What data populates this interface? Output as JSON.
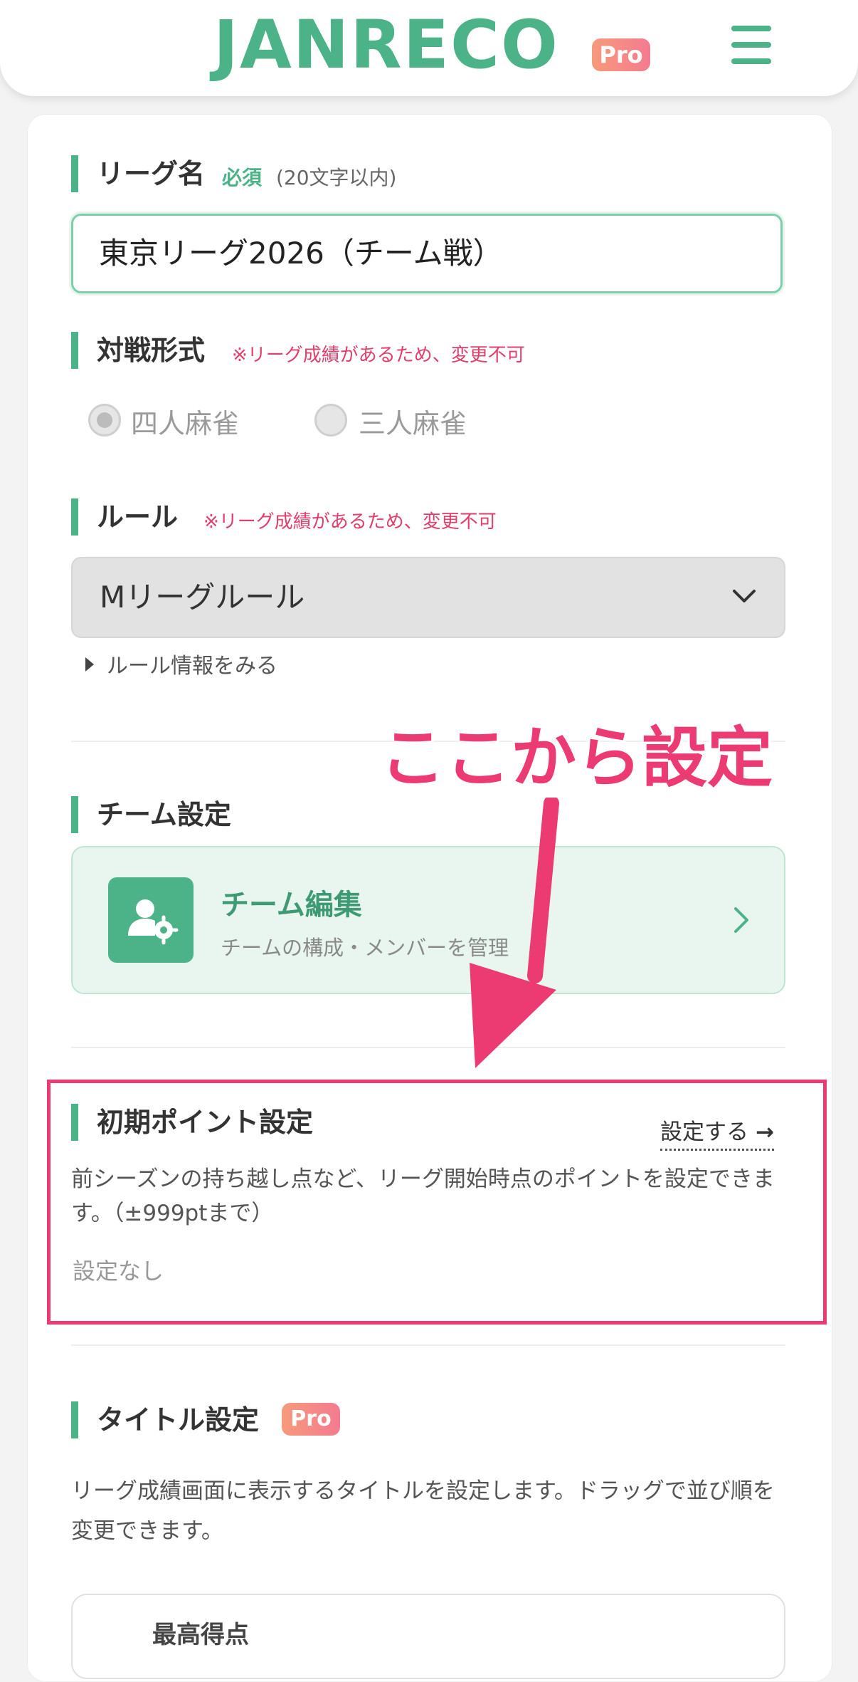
{
  "header": {
    "logo": "JANRECO",
    "badge": "Pro",
    "menu_icon": "hamburger-menu-icon"
  },
  "league_name": {
    "title": "リーグ名",
    "required": "必須",
    "limit": "(20文字以内)",
    "value": "東京リーグ2026（チーム戦）"
  },
  "match_format": {
    "title": "対戦形式",
    "note": "※リーグ成績があるため、変更不可",
    "options": [
      {
        "label": "四人麻雀",
        "selected": true
      },
      {
        "label": "三人麻雀",
        "selected": false
      }
    ]
  },
  "rule": {
    "title": "ルール",
    "note": "※リーグ成績があるため、変更不可",
    "selected": "Mリーグルール",
    "info_link": "ルール情報をみる"
  },
  "team": {
    "title": "チーム設定",
    "card_title": "チーム編集",
    "card_sub": "チームの構成・メンバーを管理",
    "icon": "user-gear-icon"
  },
  "initial_points": {
    "title": "初期ポイント設定",
    "link": "設定する",
    "description": "前シーズンの持ち越し点など、リーグ開始時点のポイントを設定できます。（±999ptまで）",
    "status": "設定なし"
  },
  "title_setting": {
    "title": "タイトル設定",
    "badge": "Pro",
    "description": "リーグ成績画面に表示するタイトルを設定します。ドラッグで並び順を変更できます。",
    "first_item": "最高得点"
  },
  "annotation": {
    "text": "ここから設定",
    "color": "#ec3a72"
  },
  "colors": {
    "accent": "#4bb387",
    "warning": "#e03f6b",
    "highlight": "#ec3a72"
  }
}
